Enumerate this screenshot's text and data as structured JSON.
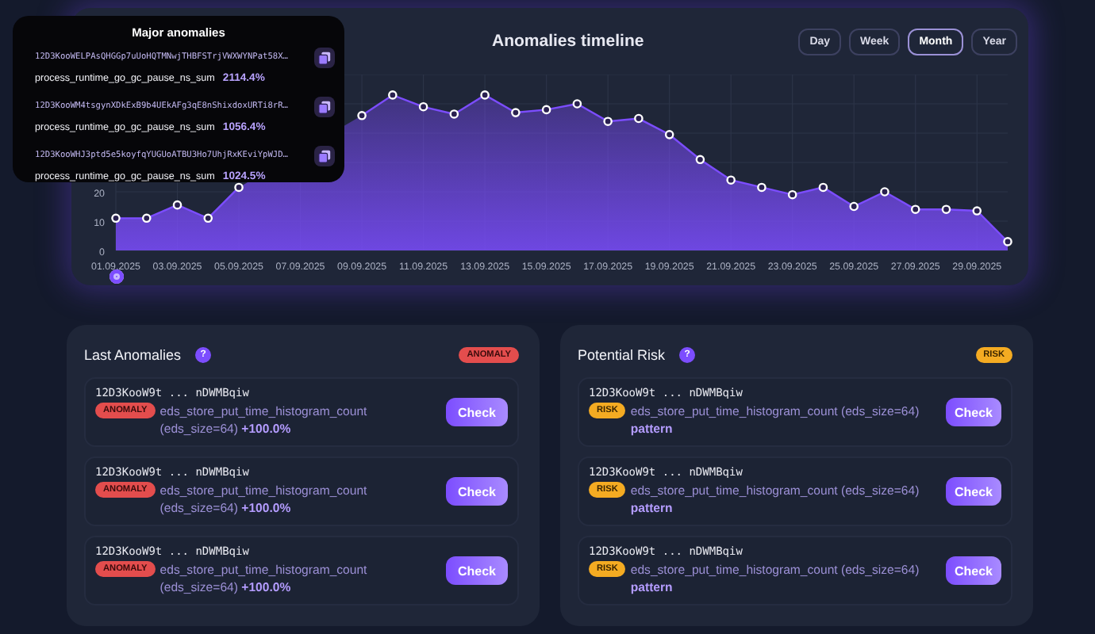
{
  "timeline": {
    "title": "Anomalies timeline",
    "ranges": [
      {
        "label": "Day",
        "selected": false
      },
      {
        "label": "Week",
        "selected": false
      },
      {
        "label": "Month",
        "selected": true
      },
      {
        "label": "Year",
        "selected": false
      }
    ],
    "chart_data": {
      "type": "area",
      "categories": [
        "01.09.2025",
        null,
        "03.09.2025",
        null,
        "05.09.2025",
        null,
        "07.09.2025",
        null,
        "09.09.2025",
        null,
        "11.09.2025",
        null,
        "13.09.2025",
        null,
        "15.09.2025",
        null,
        "17.09.2025",
        null,
        "19.09.2025",
        null,
        "21.09.2025",
        null,
        "23.09.2025",
        null,
        "25.09.2025",
        null,
        "27.09.2025",
        null,
        "29.09.2025",
        null
      ],
      "series": [
        {
          "color": "#7c4dff",
          "values": [
            11,
            11,
            15.5,
            11,
            21.5,
            null,
            null,
            null,
            46,
            53,
            49,
            46.5,
            53,
            47,
            48,
            50,
            44,
            45,
            39.5,
            31,
            24,
            21.5,
            19,
            21.5,
            15,
            20,
            14,
            14,
            13.5,
            3
          ]
        }
      ],
      "ylim": [
        0,
        60
      ],
      "yticks": [
        0,
        10,
        20
      ],
      "grid": true
    }
  },
  "tooltip": {
    "title": "Major anomalies",
    "entries": [
      {
        "id": "12D3KooWELPAsQHGGp7uUoHQTMNwjTHBFSTrjVWXWYNPat58X…",
        "metric": "process_runtime_go_gc_pause_ns_sum",
        "value": "2114.4%"
      },
      {
        "id": "12D3KooWM4tsgynXDkExB9b4UEkAFg3qE8nShixdoxURTi8rR…",
        "metric": "process_runtime_go_gc_pause_ns_sum",
        "value": "1056.4%"
      },
      {
        "id": "12D3KooWHJ3ptd5e5koyfqYUGUoATBU3Ho7UhjRxKEviYpWJD…",
        "metric": "process_runtime_go_gc_pause_ns_sum",
        "value": "1024.5%"
      }
    ]
  },
  "panels": [
    {
      "title": "Last Anomalies",
      "help": "?",
      "badge": {
        "kind": "anomaly",
        "label": "ANOMALY"
      },
      "rows": [
        {
          "id": "12D3KooW9t ... nDWMBqiw",
          "badge": {
            "kind": "anomaly",
            "label": "ANOMALY"
          },
          "metric": "eds_store_put_time_histogram_count (eds_size=64)",
          "value": "+100.0%",
          "button": "Check"
        },
        {
          "id": "12D3KooW9t ... nDWMBqiw",
          "badge": {
            "kind": "anomaly",
            "label": "ANOMALY"
          },
          "metric": "eds_store_put_time_histogram_count (eds_size=64)",
          "value": "+100.0%",
          "button": "Check"
        },
        {
          "id": "12D3KooW9t ... nDWMBqiw",
          "badge": {
            "kind": "anomaly",
            "label": "ANOMALY"
          },
          "metric": "eds_store_put_time_histogram_count (eds_size=64)",
          "value": "+100.0%",
          "button": "Check"
        }
      ]
    },
    {
      "title": "Potential Risk",
      "help": "?",
      "badge": {
        "kind": "risk",
        "label": "RISK"
      },
      "rows": [
        {
          "id": "12D3KooW9t ... nDWMBqiw",
          "badge": {
            "kind": "risk",
            "label": "RISK"
          },
          "metric": "eds_store_put_time_histogram_count (eds_size=64)",
          "value": "pattern",
          "button": "Check"
        },
        {
          "id": "12D3KooW9t ... nDWMBqiw",
          "badge": {
            "kind": "risk",
            "label": "RISK"
          },
          "metric": "eds_store_put_time_histogram_count (eds_size=64)",
          "value": "pattern",
          "button": "Check"
        },
        {
          "id": "12D3KooW9t ... nDWMBqiw",
          "badge": {
            "kind": "risk",
            "label": "RISK"
          },
          "metric": "eds_store_put_time_histogram_count (eds_size=64)",
          "value": "pattern",
          "button": "Check"
        }
      ]
    }
  ]
}
